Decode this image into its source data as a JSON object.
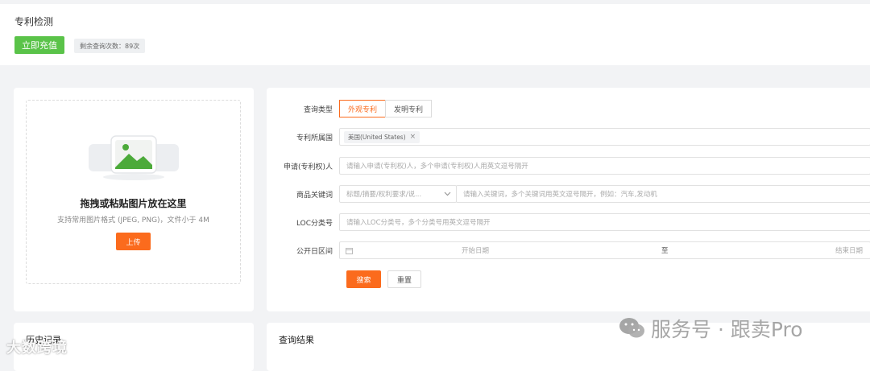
{
  "header": {
    "title": "专利检测",
    "recharge_label": "立即充值",
    "quota_text": "剩余查询次数：89次"
  },
  "upload": {
    "title": "拖拽或粘贴图片放在这里",
    "hint": "支持常用图片格式 (JPEG, PNG)，文件小于 4M",
    "button_label": "上传"
  },
  "form": {
    "query_type_label": "查询类型",
    "query_type_options": [
      "外观专利",
      "发明专利"
    ],
    "query_type_selected": "外观专利",
    "country_label": "专利所属国",
    "country_tag": "美国(United States)",
    "applicant_label": "申请(专利权)人",
    "applicant_placeholder": "请输入申请(专利权)人，多个申请(专利权)人用英文逗号隔开",
    "keyword_label": "商品关键词",
    "keyword_scope_value": "标题/摘要/权利要求/说...",
    "keyword_placeholder": "请输入关键词，多个关键词用英文逗号隔开，例如：汽车,发动机",
    "loc_label": "LOC分类号",
    "loc_placeholder": "请输入LOC分类号，多个分类号用英文逗号隔开",
    "date_label": "公开日区间",
    "date_start_placeholder": "开始日期",
    "date_separator": "至",
    "date_end_placeholder": "结束日期",
    "search_label": "搜索",
    "reset_label": "重置"
  },
  "history": {
    "title": "历史记录"
  },
  "results": {
    "title": "查询结果"
  },
  "watermarks": {
    "left": "大数跨境",
    "right": "服务号 · 跟卖Pro"
  },
  "colors": {
    "accent_orange": "#fb6b1d",
    "recharge_green": "#5ac349",
    "background": "#f2f3f5"
  }
}
